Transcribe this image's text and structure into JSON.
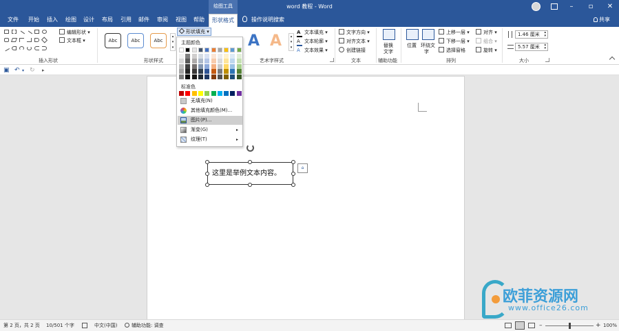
{
  "title_bar": {
    "context_tab": "绘图工具",
    "title": "word 教程 - Word",
    "buttons": {
      "minimize": "–",
      "maximize": "▫",
      "close": "✕"
    }
  },
  "tabs": [
    "文件",
    "开始",
    "插入",
    "绘图",
    "设计",
    "布局",
    "引用",
    "邮件",
    "审阅",
    "视图",
    "帮助",
    "形状格式"
  ],
  "active_tab": "形状格式",
  "tell_me": "操作说明搜索",
  "share": "共享",
  "ribbon": {
    "insert_shapes": {
      "label": "插入形状",
      "edit_shape": "编辑形状",
      "text_box": "文本框"
    },
    "shape_styles": {
      "label": "形状样式",
      "presets": [
        "Abc",
        "Abc",
        "Abc"
      ],
      "shape_fill": "形状填充"
    },
    "wordart_styles": {
      "label": "艺术字样式",
      "letters": [
        "A",
        "A"
      ],
      "text_fill": "文本填充",
      "text_outline": "文本轮廓",
      "text_effects": "文本效果"
    },
    "text": {
      "label": "文本",
      "text_direction": "文字方向",
      "align_text": "对齐文本",
      "create_link": "创建链接"
    },
    "accessibility": {
      "label": "辅助功能",
      "alt_text_line1": "替换",
      "alt_text_line2": "文字"
    },
    "arrange": {
      "label": "排列",
      "position": "位置",
      "wrap_text_line1": "环绕文",
      "wrap_text_line2": "字",
      "bring_forward": "上移一层",
      "send_backward": "下移一层",
      "selection_pane": "选择窗格",
      "align": "对齐",
      "group": "组合",
      "rotate": "旋转"
    },
    "size": {
      "label": "大小",
      "height": "1.46 厘米",
      "width": "5.57 厘米"
    }
  },
  "fill_menu": {
    "theme_colors_label": "主题颜色",
    "theme_colors": [
      [
        "#ffffff",
        "#000000",
        "#e7e6e6",
        "#44546a",
        "#4472c4",
        "#ed7d31",
        "#a5a5a5",
        "#ffc000",
        "#5b9bd5",
        "#70ad47"
      ],
      [
        "#f2f2f2",
        "#7f7f7f",
        "#d0cece",
        "#d6dce4",
        "#d9e2f3",
        "#fbe5d5",
        "#ededed",
        "#fff2cc",
        "#deebf6",
        "#e2efd9"
      ],
      [
        "#d8d8d8",
        "#595959",
        "#aeabab",
        "#adb9ca",
        "#b4c6e7",
        "#f7cbac",
        "#dbdbdb",
        "#fee599",
        "#bdd7ee",
        "#c5e0b3"
      ],
      [
        "#bfbfbf",
        "#3f3f3f",
        "#757070",
        "#8496b0",
        "#8eaadb",
        "#f4b183",
        "#c9c9c9",
        "#ffd965",
        "#9cc3e5",
        "#a8d08d"
      ],
      [
        "#a5a5a5",
        "#262626",
        "#3a3838",
        "#323f4f",
        "#2f5496",
        "#c55a11",
        "#7b7b7b",
        "#bf8f00",
        "#2e75b5",
        "#538135"
      ],
      [
        "#7f7f7f",
        "#0c0c0c",
        "#171616",
        "#222a35",
        "#1f3864",
        "#833c0b",
        "#525252",
        "#7f6000",
        "#1e4e79",
        "#375623"
      ]
    ],
    "standard_colors_label": "标准色",
    "standard_colors": [
      "#c00000",
      "#ff0000",
      "#ffc000",
      "#ffff00",
      "#92d050",
      "#00b050",
      "#00b0f0",
      "#0070c0",
      "#002060",
      "#7030a0"
    ],
    "items": [
      {
        "label": "无填充(N)"
      },
      {
        "label": "其他填充颜色(M)..."
      },
      {
        "label": "图片(P)...",
        "highlighted": true
      },
      {
        "label": "渐变(G)",
        "submenu": true
      },
      {
        "label": "纹理(T)",
        "submenu": true
      }
    ]
  },
  "document": {
    "textbox_text": "这里是举例文本内容。"
  },
  "status_bar": {
    "page": "第 2 页，共 2 页",
    "words": "10/501 个字",
    "language": "中文(中国)",
    "accessibility": "辅助功能: 调查",
    "zoom": "100%",
    "zoom_level": 0.5
  },
  "watermark": {
    "title": "欧菲资源网",
    "url": "www.office26.com"
  },
  "colors": {
    "brand": "#2b579a",
    "menu_highlight": "#cfcfcf"
  }
}
